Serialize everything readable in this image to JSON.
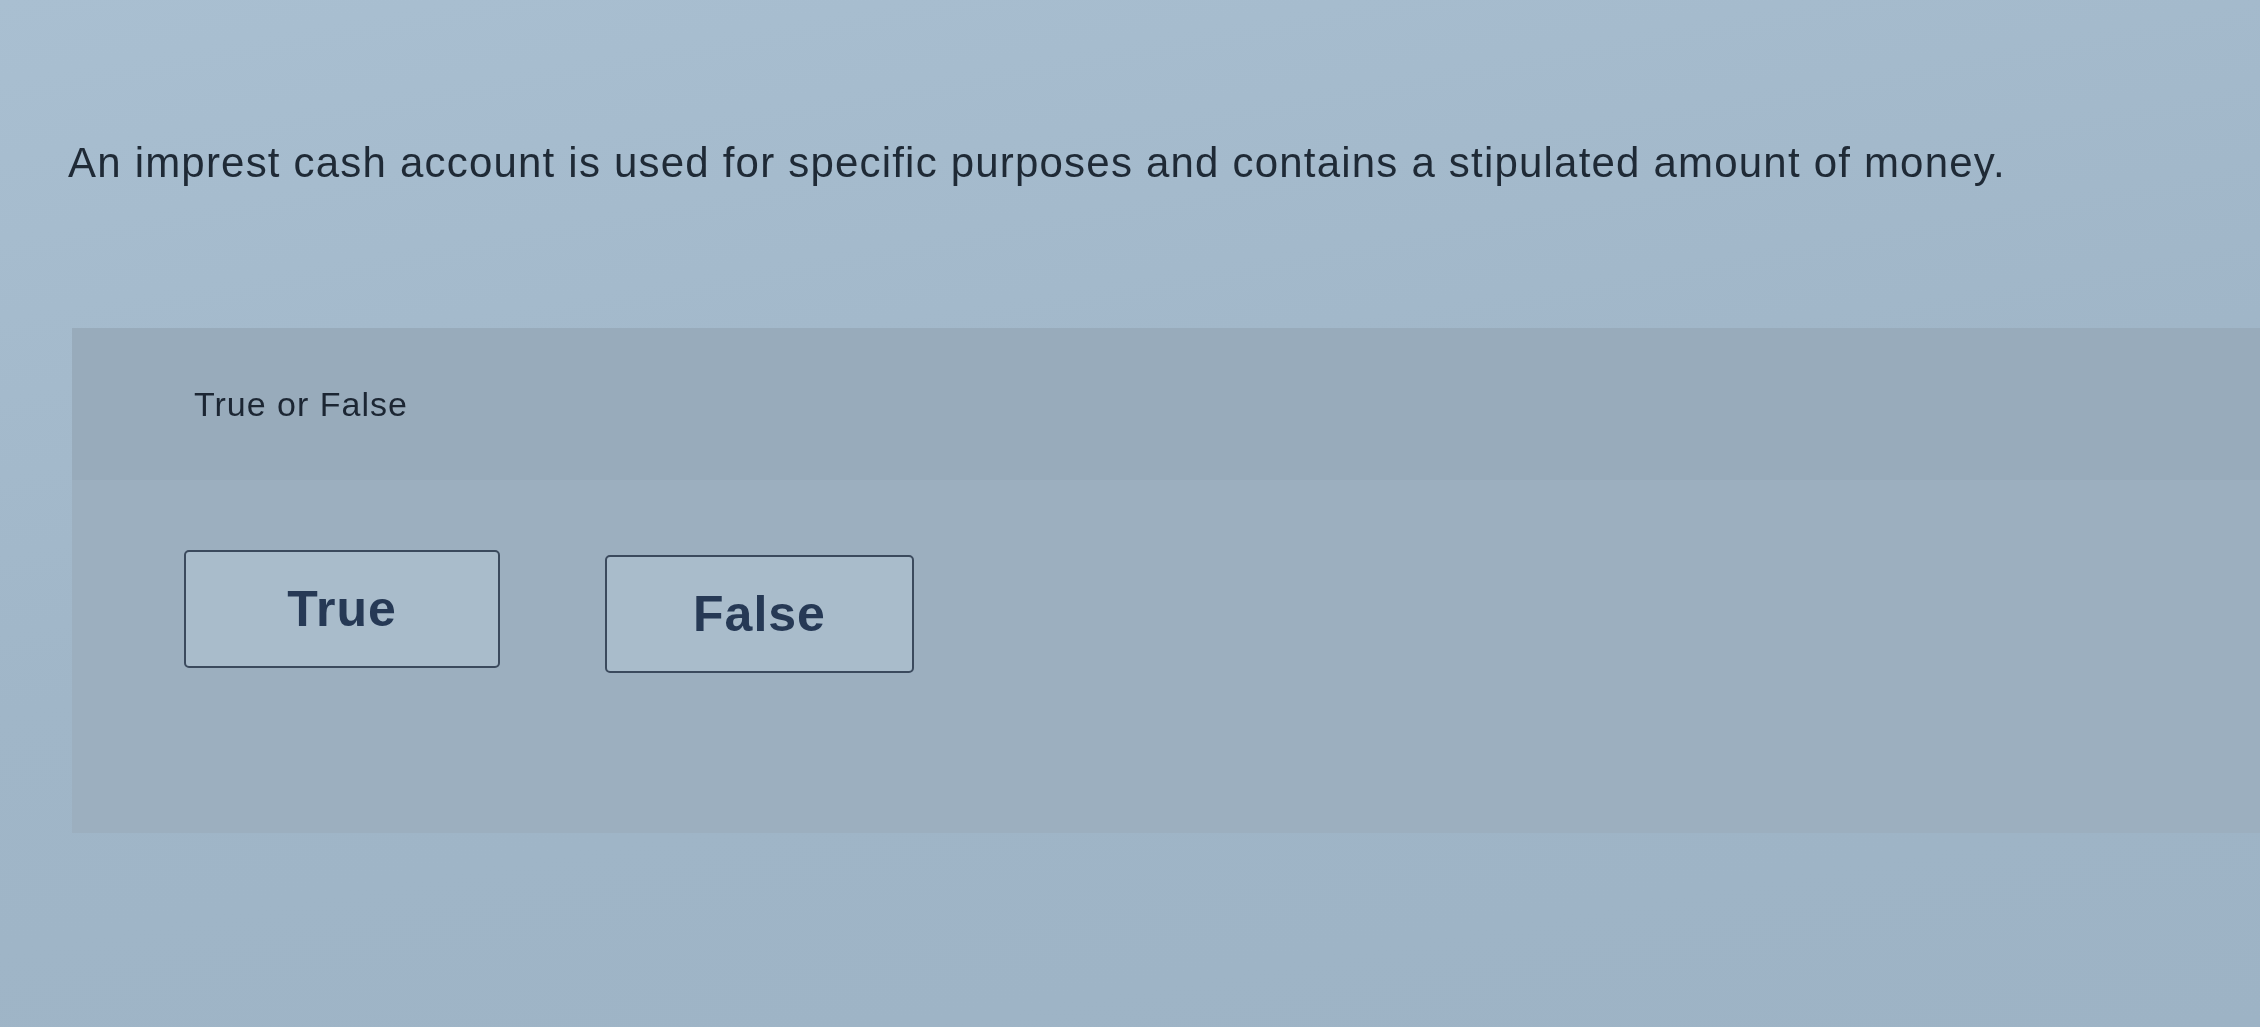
{
  "question": {
    "text": "An imprest cash account is used for specific purposes and contains a stipulated amount of money."
  },
  "answer_panel": {
    "heading": "True or False",
    "choices": [
      {
        "label": "True",
        "selected": false
      },
      {
        "label": "False",
        "selected": false
      }
    ]
  }
}
